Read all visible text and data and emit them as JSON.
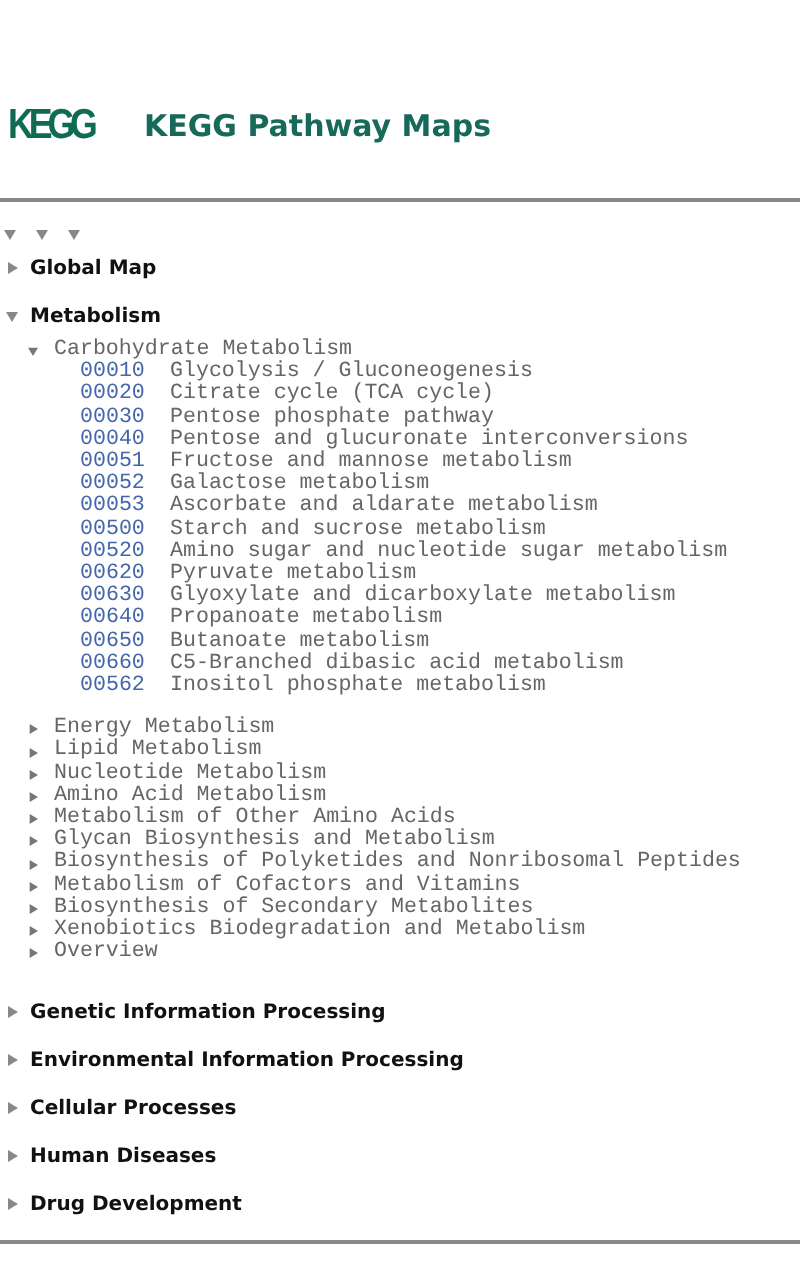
{
  "header": {
    "logo": "KEGG",
    "title": "KEGG Pathway Maps"
  },
  "categories": [
    {
      "name": "Global Map",
      "expanded": false
    },
    {
      "name": "Metabolism",
      "expanded": true,
      "children": [
        {
          "name": "Carbohydrate Metabolism",
          "expanded": true,
          "children": [
            {
              "code": "00010",
              "name": "Glycolysis / Gluconeogenesis"
            },
            {
              "code": "00020",
              "name": "Citrate cycle (TCA cycle)"
            },
            {
              "code": "00030",
              "name": "Pentose phosphate pathway"
            },
            {
              "code": "00040",
              "name": "Pentose and glucuronate interconversions"
            },
            {
              "code": "00051",
              "name": "Fructose and mannose metabolism"
            },
            {
              "code": "00052",
              "name": "Galactose metabolism"
            },
            {
              "code": "00053",
              "name": "Ascorbate and aldarate metabolism"
            },
            {
              "code": "00500",
              "name": "Starch and sucrose metabolism"
            },
            {
              "code": "00520",
              "name": "Amino sugar and nucleotide sugar metabolism"
            },
            {
              "code": "00620",
              "name": "Pyruvate metabolism"
            },
            {
              "code": "00630",
              "name": "Glyoxylate and dicarboxylate metabolism"
            },
            {
              "code": "00640",
              "name": "Propanoate metabolism"
            },
            {
              "code": "00650",
              "name": "Butanoate metabolism"
            },
            {
              "code": "00660",
              "name": "C5-Branched dibasic acid metabolism"
            },
            {
              "code": "00562",
              "name": "Inositol phosphate metabolism"
            }
          ]
        },
        {
          "name": "Energy Metabolism",
          "expanded": false
        },
        {
          "name": "Lipid Metabolism",
          "expanded": false
        },
        {
          "name": "Nucleotide Metabolism",
          "expanded": false
        },
        {
          "name": "Amino Acid Metabolism",
          "expanded": false
        },
        {
          "name": "Metabolism of Other Amino Acids",
          "expanded": false
        },
        {
          "name": "Glycan Biosynthesis and Metabolism",
          "expanded": false
        },
        {
          "name": "Biosynthesis of Polyketides and Nonribosomal Peptides",
          "expanded": false
        },
        {
          "name": "Metabolism of Cofactors and Vitamins",
          "expanded": false
        },
        {
          "name": "Biosynthesis of Secondary Metabolites",
          "expanded": false
        },
        {
          "name": "Xenobiotics Biodegradation and Metabolism",
          "expanded": false
        },
        {
          "name": "Overview",
          "expanded": false
        }
      ]
    },
    {
      "name": "Genetic Information Processing",
      "expanded": false
    },
    {
      "name": "Environmental Information Processing",
      "expanded": false
    },
    {
      "name": "Cellular Processes",
      "expanded": false
    },
    {
      "name": "Human Diseases",
      "expanded": false
    },
    {
      "name": "Drug Development",
      "expanded": false
    }
  ]
}
